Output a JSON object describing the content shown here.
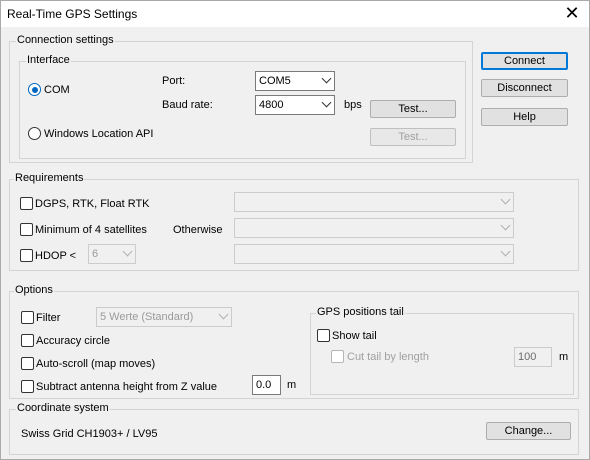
{
  "window": {
    "title": "Real-Time GPS Settings"
  },
  "connection": {
    "legend": "Connection settings",
    "interface_legend": "Interface",
    "com_label": "COM",
    "port_label": "Port:",
    "port_value": "COM5",
    "baud_label": "Baud rate:",
    "baud_value": "4800",
    "bps_label": "bps",
    "test_label": "Test...",
    "windows_api_label": "Windows Location API",
    "test2_label": "Test..."
  },
  "side_buttons": {
    "connect": "Connect",
    "disconnect": "Disconnect",
    "help": "Help"
  },
  "requirements": {
    "legend": "Requirements",
    "dgps_label": "DGPS, RTK, Float RTK",
    "min_sat_label": "Minimum of 4 satellites",
    "otherwise_label": "Otherwise",
    "hdop_label": "HDOP <",
    "hdop_value": "6"
  },
  "options": {
    "legend": "Options",
    "filter_label": "Filter",
    "filter_value": "5 Werte (Standard)",
    "accuracy_label": "Accuracy circle",
    "autoscroll_label": "Auto-scroll (map moves)",
    "subtract_label": "Subtract antenna height from Z value",
    "subtract_value": "0.0",
    "subtract_unit": "m",
    "tail_legend": "GPS positions tail",
    "show_tail_label": "Show tail",
    "cut_tail_label": "Cut tail by length",
    "cut_tail_value": "100",
    "cut_tail_unit": "m"
  },
  "coordinate": {
    "legend": "Coordinate system",
    "value": "Swiss Grid  CH1903+ / LV95",
    "change_label": "Change..."
  },
  "colors": {
    "accent": "#0067c0",
    "focus_border": "#0078d7"
  }
}
